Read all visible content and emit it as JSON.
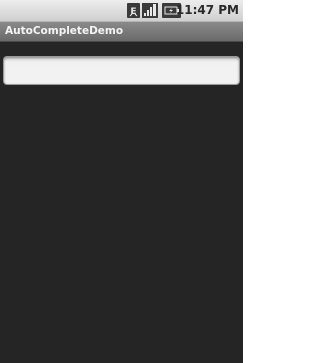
{
  "status_bar": {
    "icons": [
      {
        "name": "edge-network-icon",
        "glyph": "E"
      },
      {
        "name": "signal-strength-icon"
      },
      {
        "name": "battery-charging-icon"
      }
    ],
    "time": "11:47 PM"
  },
  "title_bar": {
    "title": "AutoCompleteDemo"
  },
  "content": {
    "autocomplete_field": {
      "value": "",
      "placeholder": ""
    }
  },
  "colors": {
    "background": "#252525",
    "status_bar": "#dcdcdc",
    "title_bar": "#7a7a7a",
    "title_text": "#f4f4f4",
    "field_background": "#f1f1f1"
  }
}
